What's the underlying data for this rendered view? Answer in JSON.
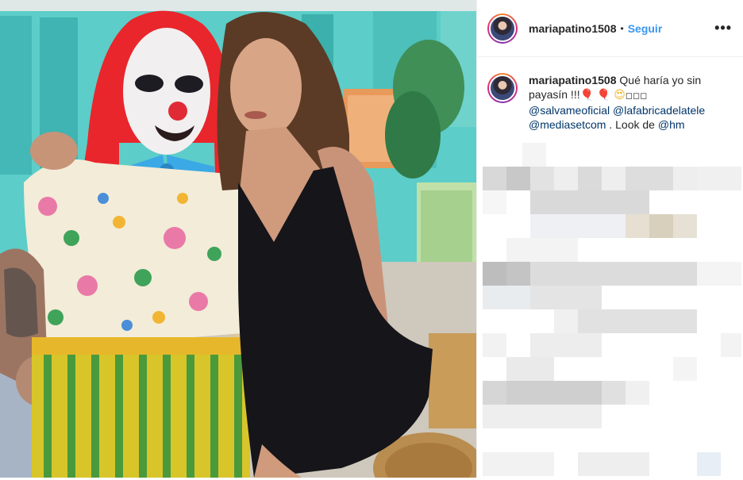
{
  "post": {
    "username": "mariapatino1508",
    "separator": "•",
    "follow_label": "Seguir",
    "more_label": "•••",
    "caption": {
      "username": "mariapatino1508",
      "text_start": "Qué haría yo sin payasín !!!",
      "balloon_1": "🎈",
      "balloon_2": "🎈",
      "emoji": "😍",
      "boxes": "◻◻◻",
      "mentions": [
        "@salvameoficial",
        "@lafabricadelatele",
        "@mediasetcom"
      ],
      "look_text": ". Look de",
      "brand_mention": "@hm"
    },
    "comments_blurred": true
  },
  "icons": {
    "avatar": "profile-photo",
    "more": "more-horizontal-icon"
  },
  "colors": {
    "link": "#3897f0",
    "mention": "#003569",
    "text": "#262626",
    "border": "#efefef",
    "clown_hair": "#e8262c",
    "dress": "#15151a"
  }
}
